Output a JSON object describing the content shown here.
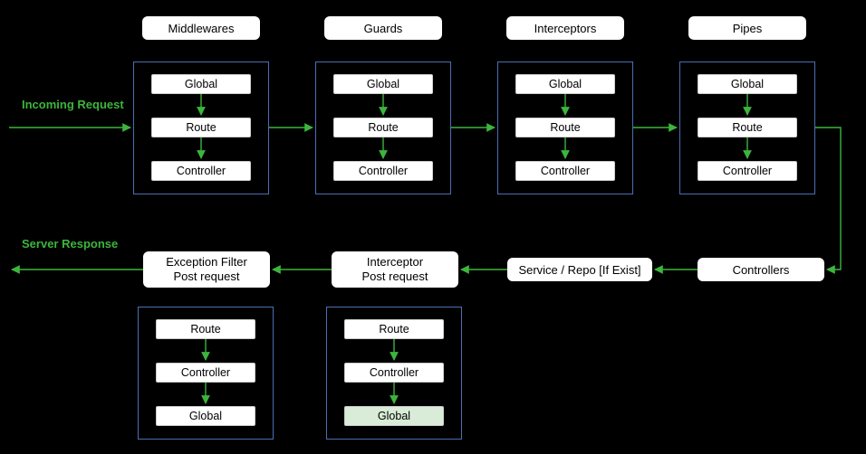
{
  "labels": {
    "incoming": "Incoming Request",
    "response": "Server Response"
  },
  "topHeaders": {
    "middlewares": "Middlewares",
    "guards": "Guards",
    "interceptors": "Interceptors",
    "pipes": "Pipes"
  },
  "controllers": "Controllers",
  "serviceRepo": "Service / Repo [If Exist]",
  "interceptorPost": {
    "line1": "Interceptor",
    "line2": "Post request"
  },
  "exceptionPost": {
    "line1": "Exception Filter",
    "line2": "Post request"
  },
  "stack": {
    "global": "Global",
    "route": "Route",
    "controller": "Controller"
  },
  "stackReverse": {
    "route": "Route",
    "controller": "Controller",
    "global": "Global"
  }
}
